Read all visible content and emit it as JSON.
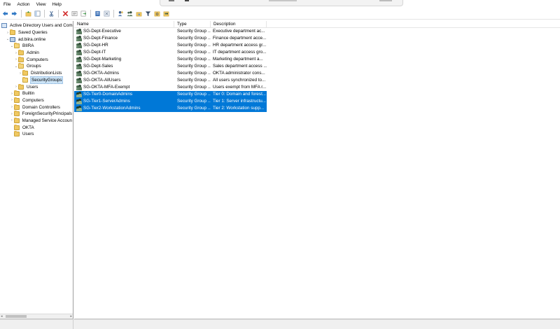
{
  "menu": [
    "File",
    "Action",
    "View",
    "Help"
  ],
  "toolbar": [
    {
      "icon": "back-arrow-icon"
    },
    {
      "icon": "forward-arrow-icon"
    },
    {
      "icon": "up-folder-icon"
    },
    {
      "icon": "show-console-tree-icon"
    },
    {
      "icon": "cut-icon"
    },
    {
      "icon": "delete-icon"
    },
    {
      "icon": "properties-icon"
    },
    {
      "icon": "refresh-icon"
    },
    {
      "icon": "export-list-icon"
    },
    {
      "icon": "help-icon"
    },
    {
      "icon": "new-user-icon"
    },
    {
      "icon": "new-group-icon"
    },
    {
      "icon": "new-ou-icon"
    },
    {
      "icon": "filter-icon"
    },
    {
      "icon": "find-icon"
    },
    {
      "icon": "add-to-group-icon"
    }
  ],
  "tree": {
    "items": [
      {
        "label": "Active Directory Users and Comp",
        "icon": "ad-console-icon",
        "depth": 0,
        "expander": ""
      },
      {
        "label": "Saved Queries",
        "icon": "folder-icon",
        "depth": 1,
        "expander": "›"
      },
      {
        "label": "ad.biira.online",
        "icon": "domain-icon",
        "depth": 1,
        "expander": "⌄"
      },
      {
        "label": "BIIRA",
        "icon": "ou-folder-icon",
        "depth": 2,
        "expander": "⌄"
      },
      {
        "label": "Admin",
        "icon": "ou-folder-icon",
        "depth": 3,
        "expander": "›"
      },
      {
        "label": "Computers",
        "icon": "ou-folder-icon",
        "depth": 3,
        "expander": "›"
      },
      {
        "label": "Groups",
        "icon": "ou-folder-icon",
        "depth": 3,
        "expander": "⌄"
      },
      {
        "label": "DistributionLists",
        "icon": "ou-folder-icon",
        "depth": 4,
        "expander": "›"
      },
      {
        "label": "SecurityGroups",
        "icon": "ou-folder-icon",
        "depth": 4,
        "expander": "",
        "selected": true
      },
      {
        "label": "Users",
        "icon": "ou-folder-icon",
        "depth": 3,
        "expander": "›"
      },
      {
        "label": "Builtin",
        "icon": "folder-icon",
        "depth": 2,
        "expander": "›"
      },
      {
        "label": "Computers",
        "icon": "folder-icon",
        "depth": 2,
        "expander": "›"
      },
      {
        "label": "Domain Controllers",
        "icon": "ou-folder-icon",
        "depth": 2,
        "expander": "›"
      },
      {
        "label": "ForeignSecurityPrincipals",
        "icon": "folder-icon",
        "depth": 2,
        "expander": "›"
      },
      {
        "label": "Managed Service Accoun",
        "icon": "folder-icon",
        "depth": 2,
        "expander": "›"
      },
      {
        "label": "OKTA",
        "icon": "ou-folder-icon",
        "depth": 2,
        "expander": ""
      },
      {
        "label": "Users",
        "icon": "folder-icon",
        "depth": 2,
        "expander": ""
      }
    ]
  },
  "list": {
    "columns": {
      "name": "Name",
      "type": "Type",
      "description": "Description"
    },
    "rows": [
      {
        "name": "SG-Dept-Executive",
        "type": "Security Group ...",
        "description": "Executive department ac...",
        "selected": false
      },
      {
        "name": "SG-Dept-Finance",
        "type": "Security Group ...",
        "description": "Finance department acce...",
        "selected": false
      },
      {
        "name": "SG-Dept-HR",
        "type": "Security Group ...",
        "description": "HR department access gr...",
        "selected": false
      },
      {
        "name": "SG-Dept-IT",
        "type": "Security Group ...",
        "description": "IT department access gro...",
        "selected": false
      },
      {
        "name": "SG-Dept-Marketing",
        "type": "Security Group ...",
        "description": "Marketing department a...",
        "selected": false
      },
      {
        "name": "SG-Dept-Sales",
        "type": "Security Group ...",
        "description": "Sales department access ...",
        "selected": false
      },
      {
        "name": "SG-OKTA-Admins",
        "type": "Security Group ...",
        "description": "OKTA administrator cons...",
        "selected": false
      },
      {
        "name": "SG-OKTA-AllUsers",
        "type": "Security Group ...",
        "description": "All users synchronized to...",
        "selected": false
      },
      {
        "name": "SG-OKTA-MFA-Exempt",
        "type": "Security Group ...",
        "description": "Users exempt from MFA r...",
        "selected": false
      },
      {
        "name": "SG-Tier0-DomainAdmins",
        "type": "Security Group ...",
        "description": "Tier 0: Domain and forest...",
        "selected": true
      },
      {
        "name": "SG-Tier1-ServerAdmins",
        "type": "Security Group ...",
        "description": "Tier 1: Server infrastructu...",
        "selected": true
      },
      {
        "name": "SG-Tier2-WorkstationAdmins",
        "type": "Security Group ...",
        "description": "Tier 2: Workstation supp...",
        "selected": true
      }
    ]
  },
  "colors": {
    "selection": "#0078d7",
    "tree_selection": "#cce4f7",
    "folder": "#f0c861"
  }
}
